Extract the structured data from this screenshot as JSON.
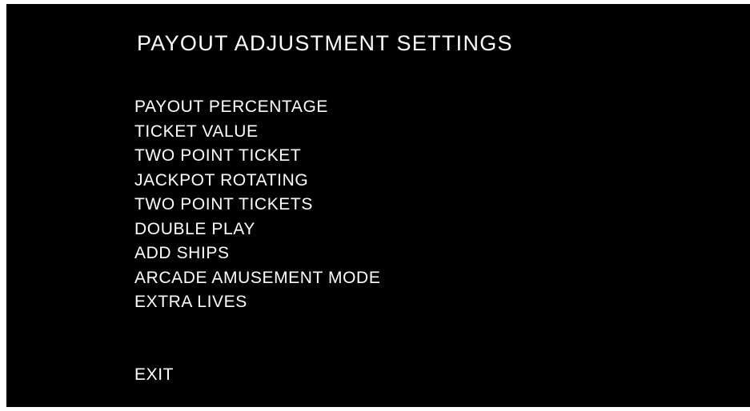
{
  "title": "PAYOUT ADJUSTMENT SETTINGS",
  "menu": {
    "items": [
      "PAYOUT PERCENTAGE",
      "TICKET VALUE",
      "TWO POINT TICKET",
      "JACKPOT ROTATING",
      "TWO POINT TICKETS",
      "DOUBLE PLAY",
      "ADD SHIPS",
      "ARCADE AMUSEMENT MODE",
      "EXTRA LIVES"
    ],
    "exit": "EXIT"
  },
  "colors": {
    "background": "#000000",
    "text": "#ffffff"
  }
}
